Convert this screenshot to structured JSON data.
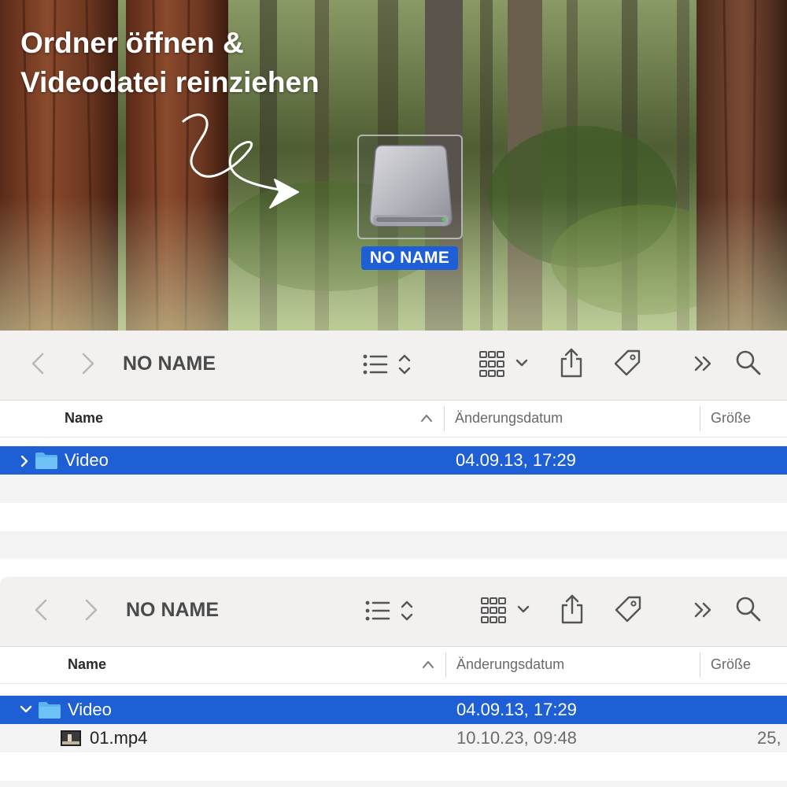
{
  "desktop": {
    "instruction_line1": "Ordner öffnen &",
    "instruction_line2": "Videodatei reinziehen",
    "drive_label": "NO NAME",
    "drive_icon": "external-drive-icon",
    "arrow_icon": "hand-drawn-arrow-icon"
  },
  "colors": {
    "selection": "#1e5fd6",
    "folder": "#5ab4f0",
    "toolbar_bg": "#f2f1ef"
  },
  "finder_collapsed": {
    "title": "NO NAME",
    "columns": {
      "name": "Name",
      "date": "Änderungsdatum",
      "size": "Größe"
    },
    "rows": [
      {
        "name": "Video",
        "date": "04.09.13, 17:29",
        "icon": "folder-icon",
        "expanded": false,
        "selected": true
      }
    ]
  },
  "finder_expanded": {
    "title": "NO NAME",
    "columns": {
      "name": "Name",
      "date": "Änderungsdatum",
      "size": "Größe"
    },
    "rows": [
      {
        "name": "Video",
        "date": "04.09.13, 17:29",
        "icon": "folder-icon",
        "expanded": true,
        "selected": true
      },
      {
        "name": "01.mp4",
        "date": "10.10.23, 09:48",
        "size": "25,",
        "icon": "video-file-icon",
        "selected": false
      }
    ]
  },
  "toolbar_icons": [
    "back-icon",
    "forward-icon",
    "list-view-icon",
    "view-options-chevron-icon",
    "gallery-grid-icon",
    "chevron-down-icon",
    "share-icon",
    "tag-icon",
    "more-icon",
    "search-icon"
  ]
}
